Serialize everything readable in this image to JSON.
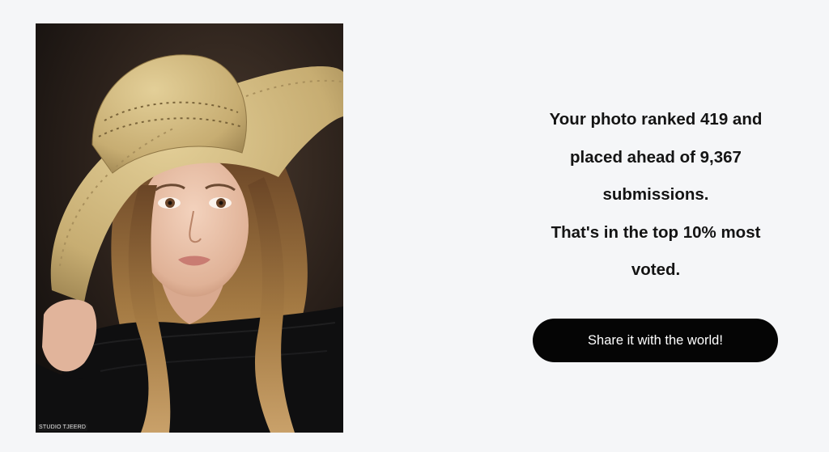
{
  "result": {
    "line1": "Your photo ranked 419 and",
    "line2": "placed ahead of 9,367",
    "line3": "submissions.",
    "line4": "That's in the top 10% most",
    "line5": "voted."
  },
  "share_button": {
    "label": "Share it with the world!"
  },
  "photo": {
    "watermark": "STUDIO TJEERD",
    "background_color": "#1c1613",
    "hat_color": "#c9b27c",
    "dress_color": "#0f0f10"
  },
  "colors": {
    "page_background": "#f5f6f8",
    "text": "#141414",
    "button_background": "#050505",
    "button_text": "#ffffff"
  }
}
